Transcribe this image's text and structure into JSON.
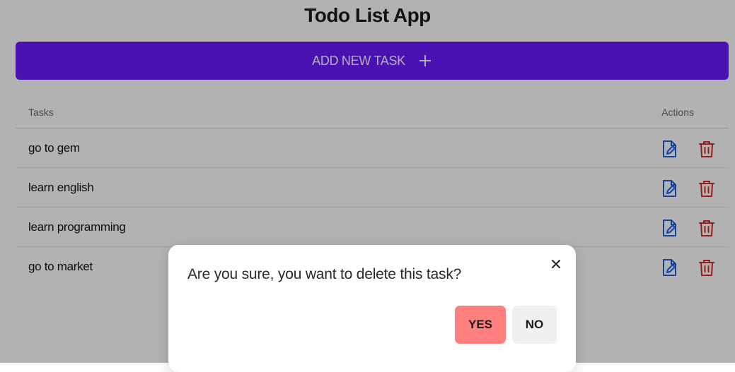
{
  "app": {
    "title": "Todo List App"
  },
  "add_button": {
    "label": "ADD NEW TASK",
    "icon": "plus-icon"
  },
  "table": {
    "headers": {
      "tasks": "Tasks",
      "actions": "Actions"
    },
    "rows": [
      {
        "task": "go to gem"
      },
      {
        "task": "learn english"
      },
      {
        "task": "learn programming"
      },
      {
        "task": "go to market"
      }
    ],
    "action_icons": [
      "edit-icon",
      "trash-icon"
    ]
  },
  "dialog": {
    "message": "Are you sure, you want to delete this task?",
    "yes_label": "YES",
    "no_label": "NO",
    "close_icon": "close-icon"
  },
  "colors": {
    "primary": "#6a1bff",
    "edit_icon": "#1f5fd6",
    "delete_icon": "#d42a2a",
    "yes_button": "#ff7f7f",
    "no_button": "#f0f0f0",
    "overlay": "rgba(0,0,0,0.30)"
  }
}
